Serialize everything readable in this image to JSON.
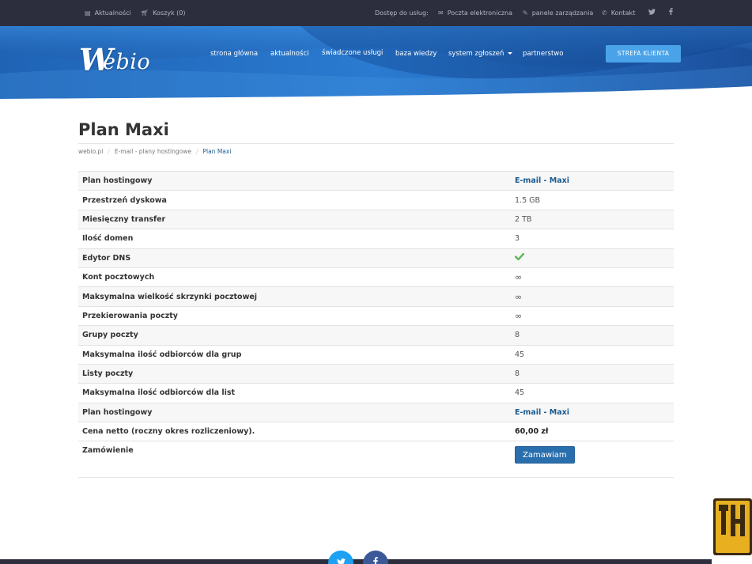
{
  "topbar": {
    "news": "Aktualności",
    "cart": "Koszyk (0)",
    "access": "Dostęp do usług:",
    "email": "Poczta elektroniczna",
    "panels": "panele zarządzania",
    "contact": "Kontakt"
  },
  "brand": {
    "logo_text": "Webio"
  },
  "nav": {
    "home": "strona główna",
    "news": "aktualności",
    "services": "świadczone usługi",
    "kb": "baza wiedzy",
    "tickets": "system zgłoszeń",
    "partners": "partnerstwo",
    "client_zone": "STREFA KLIENTA"
  },
  "page": {
    "title": "Plan Maxi"
  },
  "breadcrumb": {
    "home": "webio.pl",
    "section": "E-mail - plany hostingowe",
    "current": "Plan Maxi"
  },
  "specs": [
    {
      "label": "Plan hostingowy",
      "value": "E-mail - Maxi"
    },
    {
      "label": "Przestrzeń dyskowa",
      "value": "1.5 GB"
    },
    {
      "label": "Miesięczny transfer",
      "value": "2 TB"
    },
    {
      "label": "Ilość domen",
      "value": "3"
    },
    {
      "label": "Edytor DNS",
      "value": ""
    },
    {
      "label": "Kont pocztowych",
      "value": "∞"
    },
    {
      "label": "Maksymalna wielkość skrzynki pocztowej",
      "value": "∞"
    },
    {
      "label": "Przekierowania poczty",
      "value": "∞"
    },
    {
      "label": "Grupy poczty",
      "value": "8"
    },
    {
      "label": "Maksymalna ilość odbiorców dla grup",
      "value": "45"
    },
    {
      "label": "Listy poczty",
      "value": "8"
    },
    {
      "label": "Maksymalna ilość odbiorców dla list",
      "value": "45"
    },
    {
      "label": "Plan hostingowy",
      "value": "E-mail - Maxi"
    },
    {
      "label": "Cena netto (roczny okres rozliczeniowy).",
      "value": "60,00 zł"
    },
    {
      "label": "Zamówienie",
      "value": "Zamawiam"
    }
  ],
  "colors": {
    "topbar": "#2c2e3e",
    "accent": "#1a5a8f",
    "button": "#2a6fad",
    "client_btn": "#4aa3e8"
  },
  "icons": [
    "envelope-icon",
    "cart-icon",
    "wrench-icon",
    "phone-icon",
    "twitter-icon",
    "facebook-icon",
    "check-icon",
    "infinity-icon"
  ]
}
